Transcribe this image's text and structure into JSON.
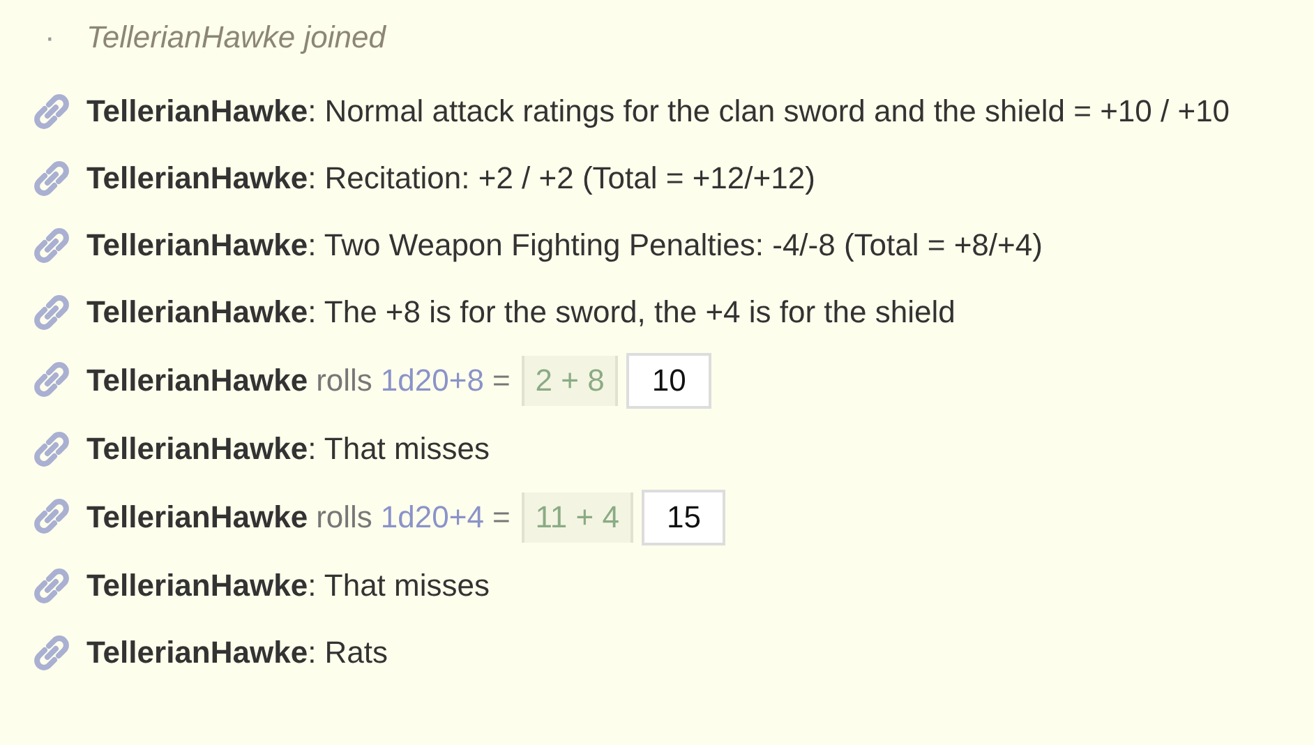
{
  "chat": [
    {
      "kind": "join",
      "bullet": "·",
      "text": "TellerianHawke joined"
    },
    {
      "kind": "message",
      "text": "**TellerianHawke**: Normal attack ratings for the clan sword and the shield = +10 / +10"
    },
    {
      "kind": "message",
      "text": "**TellerianHawke**: Recitation: +2 / +2 (Total = +12/+12)"
    },
    {
      "kind": "message",
      "text": "**TellerianHawke**: Two Weapon Fighting Penalties: -4/-8 (Total = +8/+4)"
    },
    {
      "kind": "message",
      "text": "**TellerianHawke**: The +8 is for the sword, the +4 is for the shield"
    },
    {
      "kind": "roll",
      "author": "TellerianHawke",
      "verb": "rolls",
      "formula": "1d20+8",
      "equals": "=",
      "breakdown": "2 + 8",
      "result": "10"
    },
    {
      "kind": "message",
      "text": "**TellerianHawke**: That misses"
    },
    {
      "kind": "roll",
      "author": "TellerianHawke",
      "verb": "rolls",
      "formula": "1d20+4",
      "equals": "=",
      "breakdown": "11 + 4",
      "result": "15"
    },
    {
      "kind": "message",
      "text": "**TellerianHawke**: That misses"
    },
    {
      "kind": "message",
      "text": "**TellerianHawke**: Rats"
    }
  ]
}
